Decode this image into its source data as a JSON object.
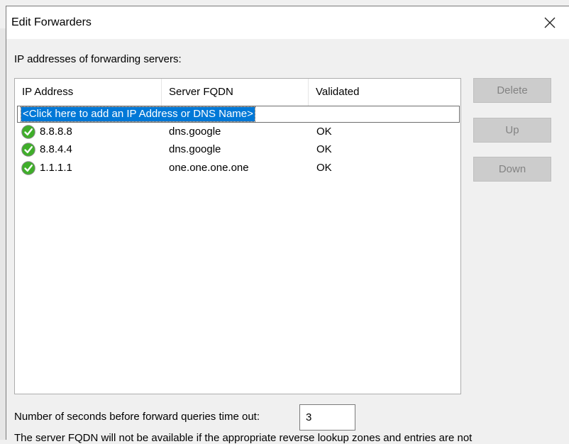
{
  "dialog": {
    "title": "Edit Forwarders",
    "close_glyph": "✕"
  },
  "section_label": "IP addresses of forwarding servers:",
  "list": {
    "columns": [
      "IP Address",
      "Server FQDN",
      "Validated"
    ],
    "add_prompt": "<Click here to add an IP Address or DNS Name>",
    "rows": [
      {
        "ip": "8.8.8.8",
        "fqdn": "dns.google",
        "validated": "OK",
        "icon": "check-circle-icon"
      },
      {
        "ip": "8.8.4.4",
        "fqdn": "dns.google",
        "validated": "OK",
        "icon": "check-circle-icon"
      },
      {
        "ip": "1.1.1.1",
        "fqdn": "one.one.one.one",
        "validated": "OK",
        "icon": "check-circle-icon"
      }
    ]
  },
  "buttons": {
    "delete": "Delete",
    "up": "Up",
    "down": "Down"
  },
  "timeout": {
    "label": "Number of seconds before forward queries time out:",
    "value": "3"
  },
  "note": "The server FQDN will not be available if the appropriate reverse lookup zones and entries are not",
  "colors": {
    "selection": "#0078d7",
    "ok_green": "#3fae2a"
  }
}
